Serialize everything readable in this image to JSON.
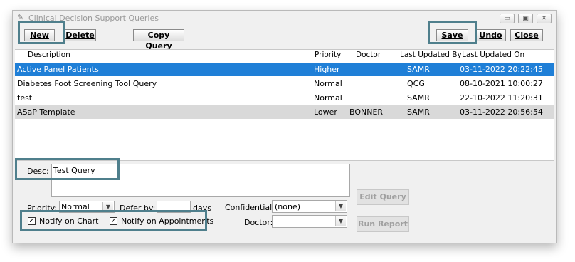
{
  "window": {
    "title": "Clinical Decision Support Queries"
  },
  "toolbar": {
    "new": "New",
    "delete": "Delete",
    "copy_query": "Copy Query",
    "save": "Save",
    "undo": "Undo",
    "close": "Close"
  },
  "table": {
    "headers": {
      "description": "Description",
      "priority": "Priority",
      "doctor": "Doctor",
      "last_updated_by": "Last Updated By",
      "last_updated_on": "Last Updated On"
    },
    "rows": [
      {
        "description": "Active Panel Patients",
        "priority": "Higher",
        "doctor": "",
        "by": "SAMR",
        "on": "03-11-2022 20:22:45",
        "selected": true
      },
      {
        "description": "Diabetes Foot Screening Tool Query",
        "priority": "Normal",
        "doctor": "",
        "by": "QCG",
        "on": "08-10-2021 10:00:27"
      },
      {
        "description": "test",
        "priority": "Normal",
        "doctor": "",
        "by": "SAMR",
        "on": "22-10-2022 11:20:31"
      },
      {
        "description": "ASaP Template",
        "priority": "Lower",
        "doctor": "BONNER",
        "by": "SAMR",
        "on": "03-11-2022 20:56:54"
      }
    ]
  },
  "form": {
    "desc_label": "Desc:",
    "desc_value": "Test Query",
    "priority_label": "Priority:",
    "priority_value": "Normal",
    "defer_label": "Defer by:",
    "defer_value": "",
    "days_label": "days",
    "confidential_label": "Confidential:",
    "confidential_value": "(none)",
    "doctor_label": "Doctor:",
    "doctor_value": "",
    "notify_chart": "Notify on Chart",
    "notify_appointments": "Notify on Appointments",
    "edit_query": "Edit Query",
    "run_report": "Run Report"
  }
}
